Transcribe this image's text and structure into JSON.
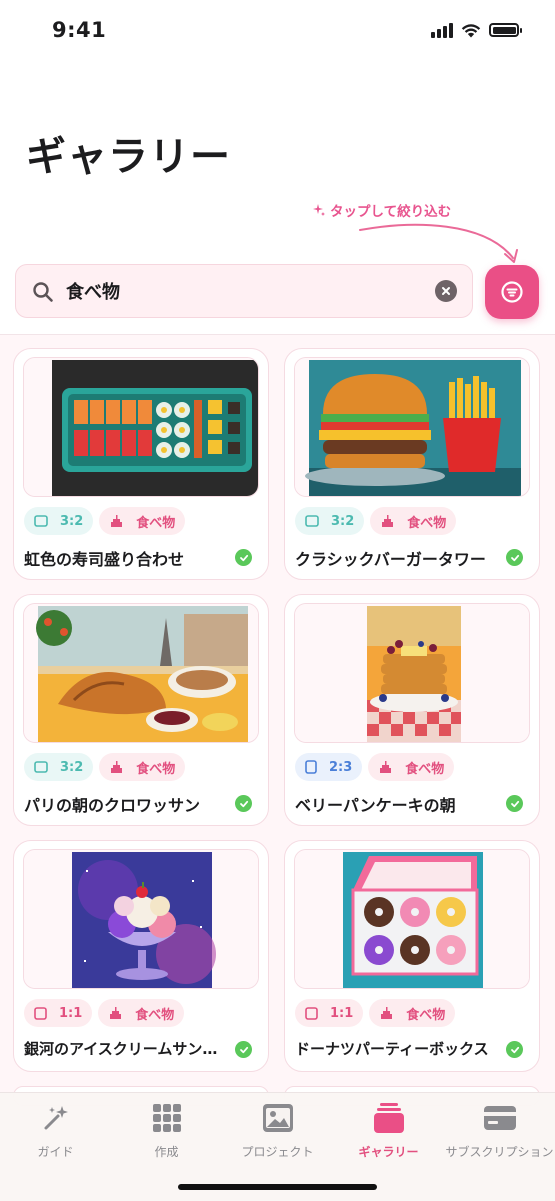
{
  "status_bar": {
    "time": "9:41"
  },
  "page": {
    "title": "ギャラリー"
  },
  "hint": {
    "text": "タップして絞り込む"
  },
  "search": {
    "value": "食べ物"
  },
  "colors": {
    "accent": "#ea4f86",
    "check": "#5ac85a"
  },
  "gallery": {
    "items": [
      {
        "title": "虹色の寿司盛り合わせ",
        "ratio": "3:2",
        "ratio_style": "teal",
        "category": "食べ物",
        "status": "check-icon"
      },
      {
        "title": "クラシックバーガータワー",
        "ratio": "3:2",
        "ratio_style": "teal",
        "category": "食べ物",
        "status": "check-icon"
      },
      {
        "title": "パリの朝のクロワッサン",
        "ratio": "3:2",
        "ratio_style": "teal",
        "category": "食べ物",
        "status": "check-icon"
      },
      {
        "title": "ベリーパンケーキの朝",
        "ratio": "2:3",
        "ratio_style": "blue",
        "category": "食べ物",
        "status": "check-icon"
      },
      {
        "title": "銀河のアイスクリームサンデー",
        "ratio": "1:1",
        "ratio_style": "pink",
        "category": "食べ物",
        "status": "check-icon"
      },
      {
        "title": "ドーナツパーティーボックス",
        "ratio": "1:1",
        "ratio_style": "pink",
        "category": "食べ物",
        "status": "check-icon"
      }
    ]
  },
  "tab_bar": {
    "tabs": [
      {
        "label": "ガイド",
        "icon": "magic-wand-icon",
        "active": false
      },
      {
        "label": "作成",
        "icon": "grid-icon",
        "active": false
      },
      {
        "label": "プロジェクト",
        "icon": "image-icon",
        "active": false
      },
      {
        "label": "ギャラリー",
        "icon": "gallery-icon",
        "active": true
      },
      {
        "label": "サブスクリプション",
        "icon": "card-icon",
        "active": false
      }
    ]
  }
}
